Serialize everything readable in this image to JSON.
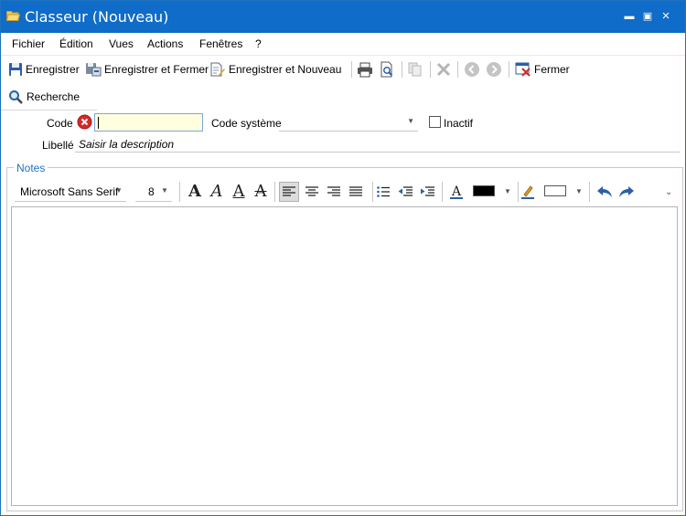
{
  "window": {
    "title": "Classeur (Nouveau)",
    "icon": "folder-open-icon",
    "controls": {
      "minimize": "▬",
      "maximize": "▣",
      "close": "×"
    }
  },
  "menu": [
    "Fichier",
    "Édition",
    "Vues",
    "Actions",
    "Fenêtres",
    "?"
  ],
  "toolbar": {
    "save": "Enregistrer",
    "save_close": "Enregistrer et Fermer",
    "save_new": "Enregistrer et Nouveau",
    "close": "Fermer"
  },
  "search": {
    "label": "Recherche"
  },
  "form": {
    "code_label": "Code",
    "code_value": "",
    "system_code_label": "Code système",
    "system_code_value": "",
    "inactive_label": "Inactif",
    "inactive_checked": false,
    "libelle_label": "Libellé",
    "libelle_placeholder": "Saisir la description"
  },
  "notes": {
    "label": "Notes",
    "font_name": "Microsoft Sans Serif",
    "font_size": "8",
    "text_color": "#000000",
    "highlight_color": "#ffffff",
    "content": ""
  }
}
